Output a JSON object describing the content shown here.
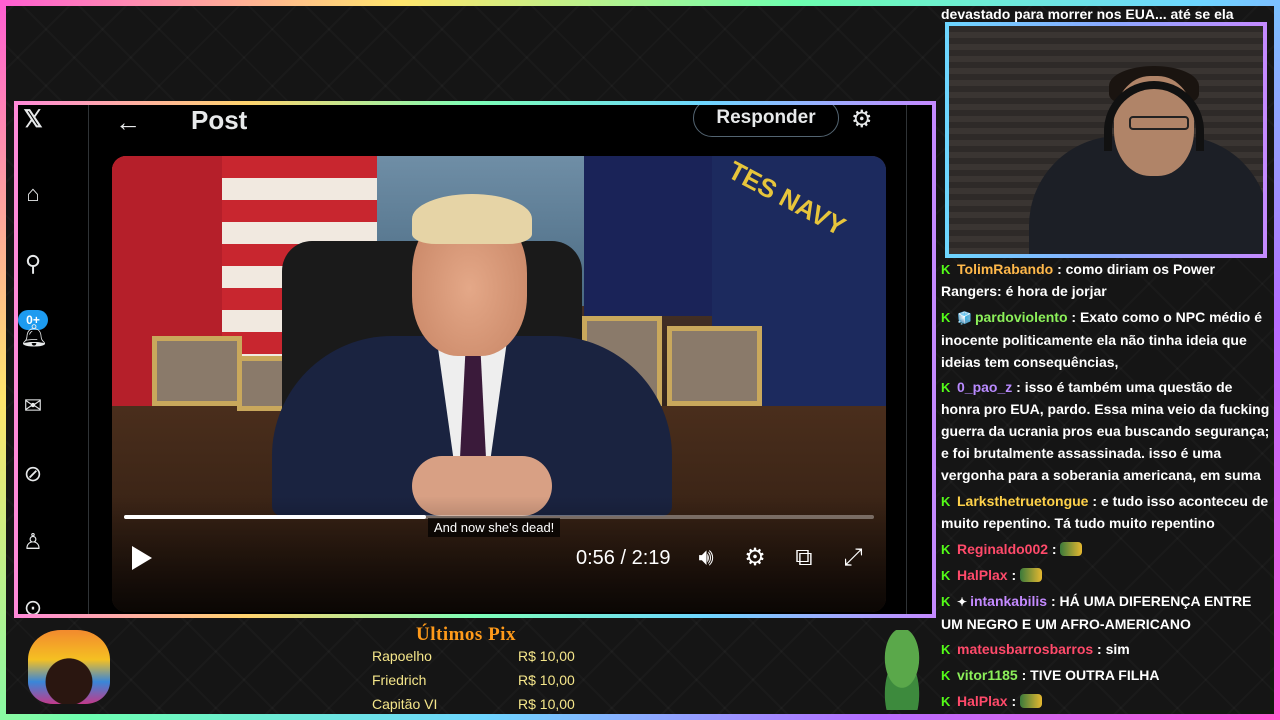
{
  "x_app": {
    "nav_icons": [
      "x-logo-icon",
      "home-icon",
      "search-icon",
      "notifications-icon",
      "messages-icon",
      "grok-icon",
      "profile-icon",
      "more-icon"
    ],
    "notification_badge": "0+",
    "header": {
      "title": "Post",
      "reply_label": "Responder"
    }
  },
  "video": {
    "caption": "And now she's dead!",
    "time": "0:56 / 2:19",
    "progress": 0.403,
    "navy_flag_text": "TES NAVY"
  },
  "chat": {
    "top_fragment": "devastado para morrer nos EUA... até se ela",
    "messages": [
      {
        "user": "TolimRabando",
        "color": "#ffb84a",
        "text": " : como diriam os Power Rangers: é hora de jorjar",
        "badge": ""
      },
      {
        "user": "pardoviolento",
        "color": "#8cf05a",
        "text": " : Exato como o NPC médio é inocente politicamente ela não tinha ideia que ideias tem consequências,",
        "badge": "🧊"
      },
      {
        "user": "0_pao_z",
        "color": "#b98aff",
        "text": " : isso é também uma questão de honra pro EUA, pardo. Essa mina veio da fucking guerra da ucrania pros eua buscando segurança; e foi brutalmente assassinada. isso é uma vergonha para a soberania americana, em suma",
        "badge": ""
      },
      {
        "user": "Larksthetruetongue",
        "color": "#ffd24a",
        "text": " : e tudo isso aconteceu de muito repentino. Tá tudo muito repentino",
        "badge": ""
      },
      {
        "user": "Reginaldo002",
        "color": "#ff4a6a",
        "text": " : ",
        "badge": "",
        "emote": true
      },
      {
        "user": "HalPlax",
        "color": "#ff4a6a",
        "text": " : ",
        "badge": "",
        "emote": true
      },
      {
        "user": "intankabilis",
        "color": "#c48aff",
        "text": " : HÁ UMA DIFERENÇA ENTRE UM NEGRO E UM AFRO-AMERICANO",
        "badge": "✦"
      },
      {
        "user": "mateusbarrosbarros",
        "color": "#ff4a6a",
        "text": " : sim",
        "badge": ""
      },
      {
        "user": "vitor1185",
        "color": "#8cf05a",
        "text": " : TIVE OUTRA FILHA",
        "badge": ""
      },
      {
        "user": "HalPlax",
        "color": "#ff4a6a",
        "text": " : ",
        "badge": "",
        "emote": true
      }
    ]
  },
  "pix": {
    "title": "Últimos Pix",
    "entries": [
      {
        "name": "Rapoelho",
        "amount": "R$ 10,00"
      },
      {
        "name": "Friedrich",
        "amount": "R$ 10,00"
      },
      {
        "name": "Capitão VI",
        "amount": "R$ 10,00"
      }
    ]
  },
  "colors": {
    "x_blue": "#1d9bf0",
    "kick_green": "#53fc18",
    "pix_title": "#ff9a1a",
    "pix_text": "#f5e68a"
  }
}
